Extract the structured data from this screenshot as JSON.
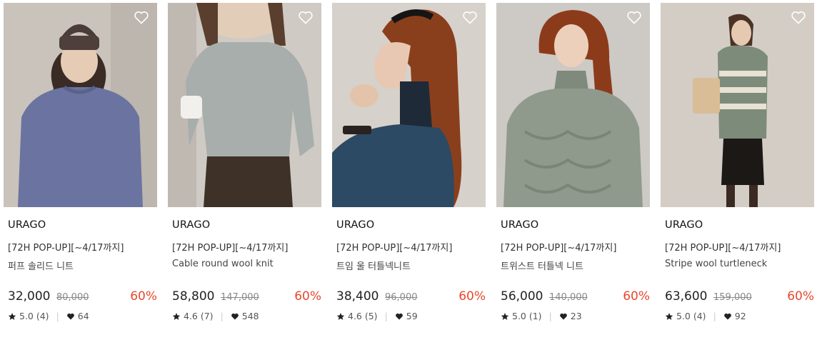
{
  "products": [
    {
      "brand": "URAGO",
      "promo": "[72H POP-UP][~4/17까지]",
      "name": "퍼프 솔리드 니트",
      "price": "32,000",
      "original_price": "80,000",
      "discount": "60%",
      "rating": "5.0 (4)",
      "likes": "64",
      "icon": "heart-outline-icon",
      "sweater_color": "#6b74a0"
    },
    {
      "brand": "URAGO",
      "promo": "[72H POP-UP][~4/17까지]",
      "name": "Cable round wool knit",
      "price": "58,800",
      "original_price": "147,000",
      "discount": "60%",
      "rating": "4.6 (7)",
      "likes": "548",
      "icon": "heart-outline-icon",
      "sweater_color": "#a7aeac"
    },
    {
      "brand": "URAGO",
      "promo": "[72H POP-UP][~4/17까지]",
      "name": "트임 울 터틀넥니트",
      "price": "38,400",
      "original_price": "96,000",
      "discount": "60%",
      "rating": "4.6 (5)",
      "likes": "59",
      "icon": "heart-outline-icon",
      "sweater_color": "#2c4a63"
    },
    {
      "brand": "URAGO",
      "promo": "[72H POP-UP][~4/17까지]",
      "name": "트위스트 터틀넥 니트",
      "price": "56,000",
      "original_price": "140,000",
      "discount": "60%",
      "rating": "5.0 (1)",
      "likes": "23",
      "icon": "heart-outline-icon",
      "sweater_color": "#8f9a8c"
    },
    {
      "brand": "URAGO",
      "promo": "[72H POP-UP][~4/17까지]",
      "name": "Stripe wool turtleneck",
      "price": "63,600",
      "original_price": "159,000",
      "discount": "60%",
      "rating": "5.0 (4)",
      "likes": "92",
      "icon": "heart-outline-icon",
      "sweater_color": "#7d8b7a"
    }
  ],
  "colors": {
    "discount": "#e8472d",
    "text": "#222222"
  }
}
